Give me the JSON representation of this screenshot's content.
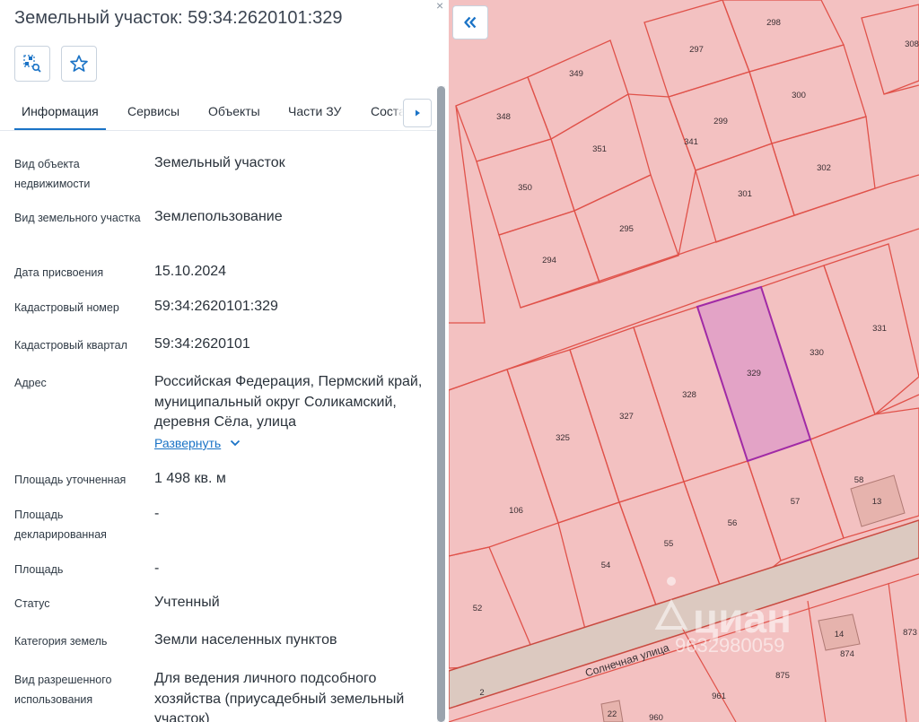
{
  "header": {
    "title": "Земельный участок: 59:34:2620101:329",
    "close_glyph": "×"
  },
  "toolbar": {
    "icons": [
      "locate-parcel-icon",
      "star-icon"
    ]
  },
  "tabs": [
    {
      "label": "Информация",
      "active": true
    },
    {
      "label": "Сервисы",
      "active": false
    },
    {
      "label": "Объекты",
      "active": false
    },
    {
      "label": "Части ЗУ",
      "active": false
    },
    {
      "label": "Состав",
      "active": false
    }
  ],
  "info": [
    {
      "label": "Вид объекта недвижимости",
      "value": "Земельный участок"
    },
    {
      "label": "Вид земельного участка",
      "value": "Землепользование"
    },
    {
      "label": "Дата присвоения",
      "value": "15.10.2024"
    },
    {
      "label": "Кадастровый номер",
      "value": "59:34:2620101:329"
    },
    {
      "label": "Кадастровый квартал",
      "value": "59:34:2620101"
    },
    {
      "label": "Адрес",
      "value": "Российская Федерация, Пермский край, муниципальный округ Соликамский, деревня Сёла, улица"
    },
    {
      "label": "Площадь уточненная",
      "value": "1 498 кв. м"
    },
    {
      "label": "Площадь декларированная",
      "value": "-"
    },
    {
      "label": "Площадь",
      "value": "-"
    },
    {
      "label": "Статус",
      "value": "Учтенный"
    },
    {
      "label": "Категория земель",
      "value": "Земли населенных пунктов"
    },
    {
      "label": "Вид разрешенного использования",
      "value": "Для ведения личного подсобного хозяйства (приусадебный земельный участок)"
    }
  ],
  "address_expand_label": "Развернуть",
  "map": {
    "street_name": "Солнечная улица",
    "watermark": "циан",
    "watermark_id": "9632980059",
    "selected_parcel": "329",
    "parcel_labels": [
      "298",
      "308",
      "297",
      "349",
      "348",
      "300",
      "351",
      "299",
      "341",
      "302",
      "350",
      "301",
      "295",
      "294",
      "331",
      "329",
      "330",
      "328",
      "327",
      "325",
      "58",
      "13",
      "57",
      "106",
      "56",
      "55",
      "54",
      "52",
      "14",
      "873",
      "874",
      "875",
      "961",
      "2",
      "22",
      "960"
    ],
    "colors": {
      "fill": "#f3c1c1",
      "parcel_stroke": "#e0524a",
      "selected_fill": "#e3a3c6",
      "selected_stroke": "#a02aa6",
      "road": "#dcc9c0"
    }
  }
}
